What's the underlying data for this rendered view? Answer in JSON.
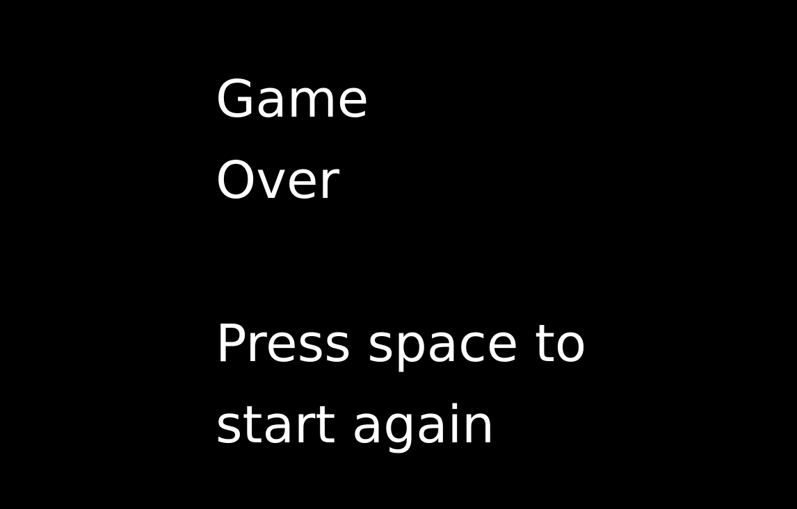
{
  "screen": {
    "background": "#000000",
    "text_color": "#ffffff",
    "title_lines": [
      "Game",
      "Over"
    ],
    "prompt_lines": [
      "Press space to",
      "start again"
    ]
  }
}
